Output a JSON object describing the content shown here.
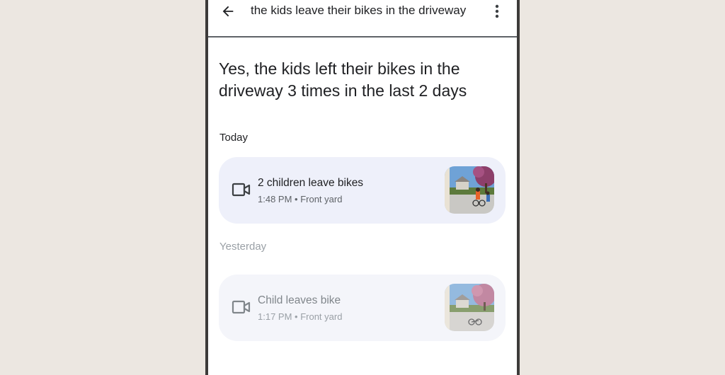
{
  "topbar": {
    "query": "the kids leave their bikes in the driveway",
    "back_icon": "arrow-back-icon",
    "more_icon": "more-vert-icon"
  },
  "answer": {
    "headline": "Yes, the kids left their bikes in the driveway 3 times in the last 2 days"
  },
  "sections": {
    "today": {
      "label": "Today",
      "event": {
        "title": "2 children leave bikes",
        "meta": "1:48 PM • Front yard",
        "icon": "videocam-icon"
      }
    },
    "yesterday": {
      "label": "Yesterday",
      "event": {
        "title": "Child leaves bike",
        "meta": "1:17 PM • Front yard",
        "icon": "videocam-icon"
      }
    }
  },
  "colors": {
    "background": "#ece7e1",
    "card_today": "#eef0fa",
    "card_yesterday": "#f4f5fa",
    "text_primary": "#202124",
    "text_muted": "#9aa0a6"
  }
}
